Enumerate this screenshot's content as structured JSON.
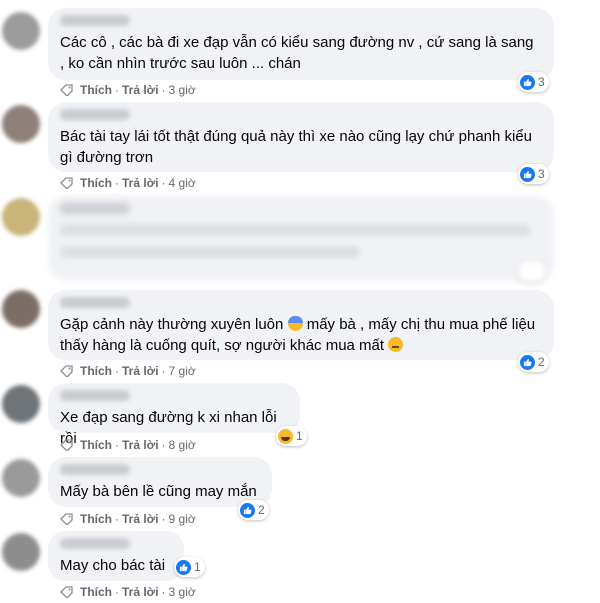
{
  "comments": [
    {
      "text": "Các cô , các bà đi xe đạp vẫn có kiểu sang đường nv , cứ sang là sang , ko cần nhìn trước sau luôn ... chán",
      "reaction_count": "3",
      "reaction": "like-icon",
      "like": "Thích",
      "reply": "Trả lời",
      "time": "3 giờ"
    },
    {
      "text": "Bác tài tay lái tốt thật đúng quả này thì xe nào cũng lạy chứ phanh kiểu gì đường trơn",
      "reaction_count": "3",
      "reaction": "like-icon",
      "like": "Thích",
      "reply": "Trả lời",
      "time": "4 giờ"
    },
    {
      "text": "",
      "reaction_count": "",
      "reaction": "",
      "like": "",
      "reply": "",
      "time": ""
    },
    {
      "text_a": "Gặp cảnh này thường xuyên luôn",
      "text_b": "mấy bà , mấy chị thu mua phế liệu thấy hàng là cuống quít, sợ người khác mua mất",
      "reaction_count": "2",
      "reaction": "like-icon",
      "like": "Thích",
      "reply": "Trả lời",
      "time": "7 giờ"
    },
    {
      "text": "Xe đạp sang đường k xi nhan lỗi rồi",
      "reaction_count": "1",
      "reaction": "haha-icon",
      "like": "Thích",
      "reply": "Trả lời",
      "time": "8 giờ"
    },
    {
      "text": "Mấy bà bên lề cũng may mắn",
      "reaction_count": "2",
      "reaction": "like-icon",
      "like": "Thích",
      "reply": "Trả lời",
      "time": "9 giờ"
    },
    {
      "text": "May cho bác tài",
      "reaction_count": "1",
      "reaction": "like-icon",
      "like": "Thích",
      "reply": "Trả lời",
      "time": "3 giờ"
    }
  ],
  "colors": {
    "like_blue": "#1877f2",
    "bubble": "#f0f2f5",
    "meta": "#65676b"
  }
}
